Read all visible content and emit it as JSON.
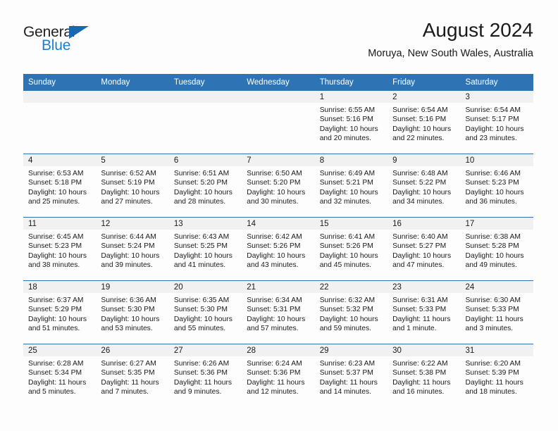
{
  "logo": {
    "word_top": "General",
    "word_bottom": "Blue",
    "triangle_color": "#1668b3",
    "blue_text_color": "#1a7fd4"
  },
  "header": {
    "title": "August 2024",
    "location": "Moruya, New South Wales, Australia"
  },
  "theme": {
    "header_blue": "#2e74b5",
    "day_number_band": "#f1f1f1",
    "page_background": "#fdfdfd"
  },
  "weekdays": [
    "Sunday",
    "Monday",
    "Tuesday",
    "Wednesday",
    "Thursday",
    "Friday",
    "Saturday"
  ],
  "weeks": [
    [
      {
        "day": "",
        "empty": true
      },
      {
        "day": "",
        "empty": true
      },
      {
        "day": "",
        "empty": true
      },
      {
        "day": "",
        "empty": true
      },
      {
        "day": "1",
        "sunrise": "Sunrise: 6:55 AM",
        "sunset": "Sunset: 5:16 PM",
        "daylight_line1": "Daylight: 10 hours",
        "daylight_line2": "and 20 minutes."
      },
      {
        "day": "2",
        "sunrise": "Sunrise: 6:54 AM",
        "sunset": "Sunset: 5:16 PM",
        "daylight_line1": "Daylight: 10 hours",
        "daylight_line2": "and 22 minutes."
      },
      {
        "day": "3",
        "sunrise": "Sunrise: 6:54 AM",
        "sunset": "Sunset: 5:17 PM",
        "daylight_line1": "Daylight: 10 hours",
        "daylight_line2": "and 23 minutes."
      }
    ],
    [
      {
        "day": "4",
        "sunrise": "Sunrise: 6:53 AM",
        "sunset": "Sunset: 5:18 PM",
        "daylight_line1": "Daylight: 10 hours",
        "daylight_line2": "and 25 minutes."
      },
      {
        "day": "5",
        "sunrise": "Sunrise: 6:52 AM",
        "sunset": "Sunset: 5:19 PM",
        "daylight_line1": "Daylight: 10 hours",
        "daylight_line2": "and 27 minutes."
      },
      {
        "day": "6",
        "sunrise": "Sunrise: 6:51 AM",
        "sunset": "Sunset: 5:20 PM",
        "daylight_line1": "Daylight: 10 hours",
        "daylight_line2": "and 28 minutes."
      },
      {
        "day": "7",
        "sunrise": "Sunrise: 6:50 AM",
        "sunset": "Sunset: 5:20 PM",
        "daylight_line1": "Daylight: 10 hours",
        "daylight_line2": "and 30 minutes."
      },
      {
        "day": "8",
        "sunrise": "Sunrise: 6:49 AM",
        "sunset": "Sunset: 5:21 PM",
        "daylight_line1": "Daylight: 10 hours",
        "daylight_line2": "and 32 minutes."
      },
      {
        "day": "9",
        "sunrise": "Sunrise: 6:48 AM",
        "sunset": "Sunset: 5:22 PM",
        "daylight_line1": "Daylight: 10 hours",
        "daylight_line2": "and 34 minutes."
      },
      {
        "day": "10",
        "sunrise": "Sunrise: 6:46 AM",
        "sunset": "Sunset: 5:23 PM",
        "daylight_line1": "Daylight: 10 hours",
        "daylight_line2": "and 36 minutes."
      }
    ],
    [
      {
        "day": "11",
        "sunrise": "Sunrise: 6:45 AM",
        "sunset": "Sunset: 5:23 PM",
        "daylight_line1": "Daylight: 10 hours",
        "daylight_line2": "and 38 minutes."
      },
      {
        "day": "12",
        "sunrise": "Sunrise: 6:44 AM",
        "sunset": "Sunset: 5:24 PM",
        "daylight_line1": "Daylight: 10 hours",
        "daylight_line2": "and 39 minutes."
      },
      {
        "day": "13",
        "sunrise": "Sunrise: 6:43 AM",
        "sunset": "Sunset: 5:25 PM",
        "daylight_line1": "Daylight: 10 hours",
        "daylight_line2": "and 41 minutes."
      },
      {
        "day": "14",
        "sunrise": "Sunrise: 6:42 AM",
        "sunset": "Sunset: 5:26 PM",
        "daylight_line1": "Daylight: 10 hours",
        "daylight_line2": "and 43 minutes."
      },
      {
        "day": "15",
        "sunrise": "Sunrise: 6:41 AM",
        "sunset": "Sunset: 5:26 PM",
        "daylight_line1": "Daylight: 10 hours",
        "daylight_line2": "and 45 minutes."
      },
      {
        "day": "16",
        "sunrise": "Sunrise: 6:40 AM",
        "sunset": "Sunset: 5:27 PM",
        "daylight_line1": "Daylight: 10 hours",
        "daylight_line2": "and 47 minutes."
      },
      {
        "day": "17",
        "sunrise": "Sunrise: 6:38 AM",
        "sunset": "Sunset: 5:28 PM",
        "daylight_line1": "Daylight: 10 hours",
        "daylight_line2": "and 49 minutes."
      }
    ],
    [
      {
        "day": "18",
        "sunrise": "Sunrise: 6:37 AM",
        "sunset": "Sunset: 5:29 PM",
        "daylight_line1": "Daylight: 10 hours",
        "daylight_line2": "and 51 minutes."
      },
      {
        "day": "19",
        "sunrise": "Sunrise: 6:36 AM",
        "sunset": "Sunset: 5:30 PM",
        "daylight_line1": "Daylight: 10 hours",
        "daylight_line2": "and 53 minutes."
      },
      {
        "day": "20",
        "sunrise": "Sunrise: 6:35 AM",
        "sunset": "Sunset: 5:30 PM",
        "daylight_line1": "Daylight: 10 hours",
        "daylight_line2": "and 55 minutes."
      },
      {
        "day": "21",
        "sunrise": "Sunrise: 6:34 AM",
        "sunset": "Sunset: 5:31 PM",
        "daylight_line1": "Daylight: 10 hours",
        "daylight_line2": "and 57 minutes."
      },
      {
        "day": "22",
        "sunrise": "Sunrise: 6:32 AM",
        "sunset": "Sunset: 5:32 PM",
        "daylight_line1": "Daylight: 10 hours",
        "daylight_line2": "and 59 minutes."
      },
      {
        "day": "23",
        "sunrise": "Sunrise: 6:31 AM",
        "sunset": "Sunset: 5:33 PM",
        "daylight_line1": "Daylight: 11 hours",
        "daylight_line2": "and 1 minute."
      },
      {
        "day": "24",
        "sunrise": "Sunrise: 6:30 AM",
        "sunset": "Sunset: 5:33 PM",
        "daylight_line1": "Daylight: 11 hours",
        "daylight_line2": "and 3 minutes."
      }
    ],
    [
      {
        "day": "25",
        "sunrise": "Sunrise: 6:28 AM",
        "sunset": "Sunset: 5:34 PM",
        "daylight_line1": "Daylight: 11 hours",
        "daylight_line2": "and 5 minutes."
      },
      {
        "day": "26",
        "sunrise": "Sunrise: 6:27 AM",
        "sunset": "Sunset: 5:35 PM",
        "daylight_line1": "Daylight: 11 hours",
        "daylight_line2": "and 7 minutes."
      },
      {
        "day": "27",
        "sunrise": "Sunrise: 6:26 AM",
        "sunset": "Sunset: 5:36 PM",
        "daylight_line1": "Daylight: 11 hours",
        "daylight_line2": "and 9 minutes."
      },
      {
        "day": "28",
        "sunrise": "Sunrise: 6:24 AM",
        "sunset": "Sunset: 5:36 PM",
        "daylight_line1": "Daylight: 11 hours",
        "daylight_line2": "and 12 minutes."
      },
      {
        "day": "29",
        "sunrise": "Sunrise: 6:23 AM",
        "sunset": "Sunset: 5:37 PM",
        "daylight_line1": "Daylight: 11 hours",
        "daylight_line2": "and 14 minutes."
      },
      {
        "day": "30",
        "sunrise": "Sunrise: 6:22 AM",
        "sunset": "Sunset: 5:38 PM",
        "daylight_line1": "Daylight: 11 hours",
        "daylight_line2": "and 16 minutes."
      },
      {
        "day": "31",
        "sunrise": "Sunrise: 6:20 AM",
        "sunset": "Sunset: 5:39 PM",
        "daylight_line1": "Daylight: 11 hours",
        "daylight_line2": "and 18 minutes."
      }
    ]
  ]
}
